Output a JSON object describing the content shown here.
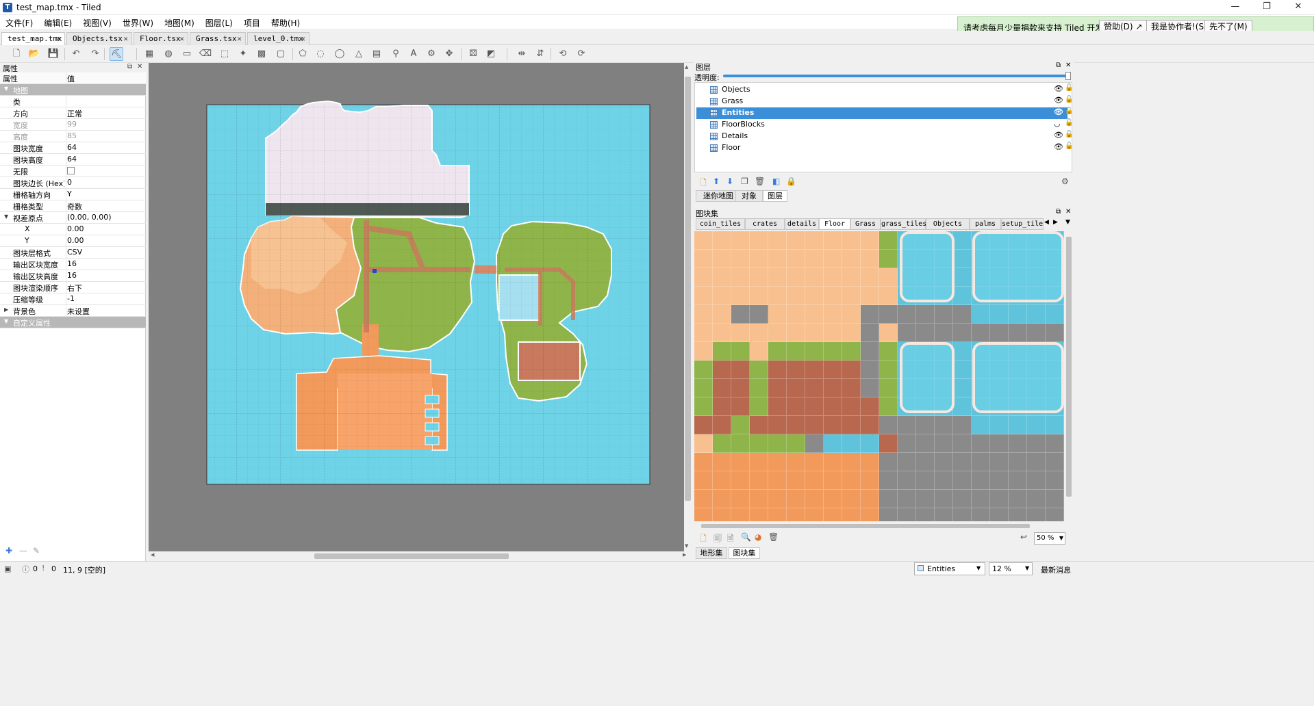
{
  "window": {
    "title": "test_map.tmx - Tiled",
    "app_icon_text": "T"
  },
  "window_buttons": [
    "—",
    "❐",
    "✕"
  ],
  "menu": [
    "文件(F)",
    "编辑(E)",
    "视图(V)",
    "世界(W)",
    "地图(M)",
    "图层(L)",
    "项目",
    "帮助(H)"
  ],
  "banner": {
    "text": "请考虑每月少量捐款来支持 Tiled 开发。",
    "buttons": [
      "赞助(D) ↗",
      "我是协作者!(S)",
      "先不了(M)"
    ]
  },
  "doc_tabs": [
    {
      "label": "test_map.tmx",
      "active": true
    },
    {
      "label": "Objects.tsx",
      "active": false
    },
    {
      "label": "Floor.tsx",
      "active": false
    },
    {
      "label": "Grass.tsx",
      "active": false
    },
    {
      "label": "level_0.tmx",
      "active": false
    }
  ],
  "toolbar": [
    {
      "name": "new-icon",
      "glyph": "🗋"
    },
    {
      "name": "open-icon",
      "glyph": "📂"
    },
    {
      "name": "save-icon",
      "glyph": "💾"
    },
    {
      "name": "undo-icon",
      "glyph": "↶"
    },
    {
      "name": "redo-icon",
      "glyph": "↷"
    },
    {
      "name": "stamp-brush-icon",
      "glyph": "⛏"
    },
    {
      "name": "terrain-brush-icon",
      "glyph": "▦"
    },
    {
      "name": "bucket-fill-icon",
      "glyph": "◍"
    },
    {
      "name": "shape-fill-icon",
      "glyph": "▭"
    },
    {
      "name": "eraser-icon",
      "glyph": "⌫"
    },
    {
      "name": "rect-select-icon",
      "glyph": "⬚"
    },
    {
      "name": "magic-wand-icon",
      "glyph": "✦"
    },
    {
      "name": "select-same-tile-icon",
      "glyph": "▩"
    },
    {
      "name": "object-rect-icon",
      "glyph": "▢"
    },
    {
      "name": "polygon-icon",
      "glyph": "⬠"
    },
    {
      "name": "object-point-icon",
      "glyph": "◌"
    },
    {
      "name": "ellipse-icon",
      "glyph": "◯"
    },
    {
      "name": "triangle-icon",
      "glyph": "△"
    },
    {
      "name": "insert-tile-icon",
      "glyph": "▤"
    },
    {
      "name": "template-icon",
      "glyph": "⚲"
    },
    {
      "name": "text-icon",
      "glyph": "A"
    },
    {
      "name": "world-tool-icon",
      "glyph": "⚙"
    },
    {
      "name": "move-icon",
      "glyph": "✥"
    },
    {
      "name": "random-mode-icon",
      "glyph": "⚄"
    },
    {
      "name": "wang-fill-icon",
      "glyph": "◩"
    },
    {
      "name": "flip-h-icon",
      "glyph": "⇹"
    },
    {
      "name": "flip-v-icon",
      "glyph": "⇵"
    },
    {
      "name": "rotate-left-icon",
      "glyph": "⟲"
    },
    {
      "name": "rotate-right-icon",
      "glyph": "⟳"
    }
  ],
  "properties": {
    "panel_title": "属性",
    "col_name": "属性",
    "col_value": "值",
    "rows": [
      {
        "k": "地图",
        "v": "",
        "type": "group"
      },
      {
        "k": "类",
        "v": ""
      },
      {
        "k": "方向",
        "v": "正常"
      },
      {
        "k": "宽度",
        "v": "99",
        "type": "dis"
      },
      {
        "k": "高度",
        "v": "85",
        "type": "dis"
      },
      {
        "k": "图块宽度",
        "v": "64"
      },
      {
        "k": "图块高度",
        "v": "64"
      },
      {
        "k": "无限",
        "v": "",
        "type": "check"
      },
      {
        "k": "图块边长 (Hex)",
        "v": "0"
      },
      {
        "k": "栅格轴方向",
        "v": "Y"
      },
      {
        "k": "栅格类型",
        "v": "奇数"
      },
      {
        "k": "视差原点",
        "v": "(0.00, 0.00)",
        "type": "expand"
      },
      {
        "k": "X",
        "v": "0.00",
        "type": "sub"
      },
      {
        "k": "Y",
        "v": "0.00",
        "type": "sub"
      },
      {
        "k": "图块层格式",
        "v": "CSV"
      },
      {
        "k": "输出区块宽度",
        "v": "16"
      },
      {
        "k": "输出区块高度",
        "v": "16"
      },
      {
        "k": "图块渲染顺序",
        "v": "右下"
      },
      {
        "k": "压缩等级",
        "v": "-1"
      },
      {
        "k": "背景色",
        "v": "未设置",
        "type": "collapsed"
      },
      {
        "k": "自定义属性",
        "v": "",
        "type": "group"
      }
    ]
  },
  "layers": {
    "panel_title": "图层",
    "opacity_label": "透明度:",
    "items": [
      {
        "name": "Objects",
        "selected": false
      },
      {
        "name": "Grass",
        "selected": false
      },
      {
        "name": "Entities",
        "selected": true
      },
      {
        "name": "FloorBlocks",
        "selected": false
      },
      {
        "name": "Details",
        "selected": false
      },
      {
        "name": "Floor",
        "selected": false
      }
    ],
    "tabs": [
      "迷你地图",
      "对象",
      "图层"
    ],
    "active_tab": "图层"
  },
  "tilesets": {
    "panel_title": "图块集",
    "tabs": [
      "coin_tiles",
      "crates",
      "details",
      "Floor",
      "Grass",
      "grass_tiles",
      "Objects",
      "palms",
      "setup_tile"
    ],
    "active_tab": "Floor",
    "zoom": "50 %",
    "bottom_tabs": [
      "地形集",
      "图块集"
    ]
  },
  "status": {
    "errors": "0",
    "warnings": "0",
    "coords": "11, 9 [空的]",
    "layer": "Entities",
    "zoom": "12 %",
    "news": "最新消息"
  },
  "colors": {
    "water": "#6fd3e8",
    "sand": "#f4b07a",
    "grass": "#8fb54a",
    "snow": "#eee5ef",
    "path": "#d6886a",
    "selection": "#3b8fd8"
  }
}
